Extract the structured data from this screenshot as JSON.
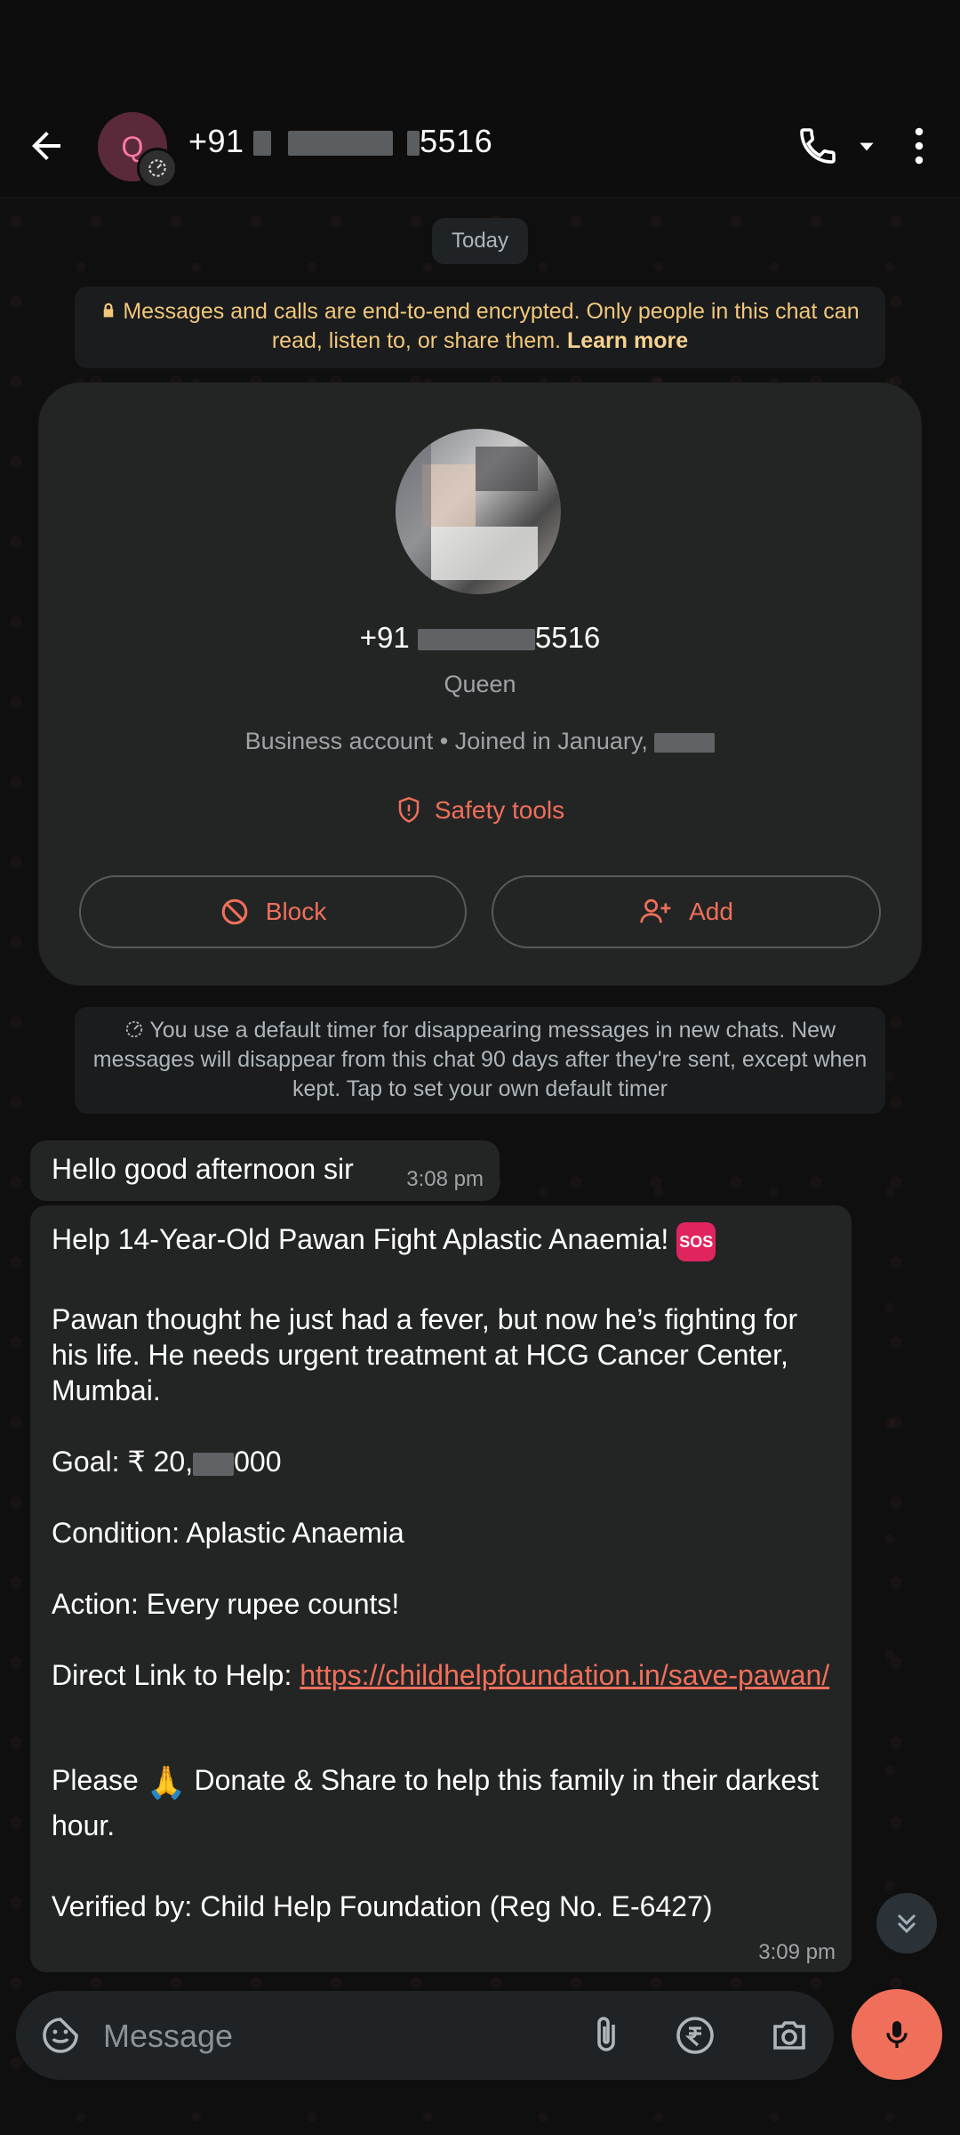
{
  "header": {
    "avatar_letter": "Q",
    "title_prefix": "+91",
    "title_suffix": "5516"
  },
  "chat": {
    "date_label": "Today",
    "encryption_text": "Messages and calls are end-to-end encrypted. Only people in this chat can read, listen to, or share them.",
    "encryption_link": "Learn more"
  },
  "profile": {
    "number_prefix": "+91",
    "number_suffix": "5516",
    "name": "Queen",
    "meta": "Business account • Joined in January,",
    "safety_label": "Safety tools",
    "block_label": "Block",
    "add_label": "Add"
  },
  "timer_note": "You use a default timer for disappearing messages in new chats. New messages will disappear from this chat 90 days after they're sent, except when kept. Tap to set your own default timer",
  "messages": [
    {
      "text": "Hello good afternoon sir",
      "time": "3:08 pm"
    },
    {
      "title": "Help 14-Year-Old Pawan Fight Aplastic Anaemia!",
      "title_emoji": "SOS",
      "para1": "Pawan thought he just had a fever, but now he’s fighting for his life. He needs urgent treatment at HCG Cancer Center, Mumbai.",
      "goal_prefix": "Goal: ₹ 20,",
      "goal_suffix": "000",
      "condition": "Condition: Aplastic Anaemia",
      "action": "Action: Every rupee counts!",
      "link_label": "Direct Link to Help:",
      "link_url": "https://childhelpfoundation.in/save-pawan/",
      "please": "Please",
      "donate": "Donate & Share to help this family in their darkest hour.",
      "verified": "Verified by: Child Help Foundation (Reg No. E-6427)",
      "time": "3:09 pm"
    }
  ],
  "composer": {
    "placeholder": "Message"
  },
  "colors": {
    "accent": "#f06f5a",
    "encryption_text": "#f3c77a",
    "bubble": "#232525"
  },
  "icons": [
    "back-arrow-icon",
    "phone-icon",
    "caret-down-icon",
    "more-vert-icon",
    "lock-icon",
    "shield-icon",
    "block-icon",
    "add-person-icon",
    "timer-icon",
    "sos-icon",
    "pray-icon",
    "double-chevron-down-icon",
    "emoji-sticker-icon",
    "attach-icon",
    "rupee-icon",
    "camera-icon",
    "mic-icon"
  ]
}
